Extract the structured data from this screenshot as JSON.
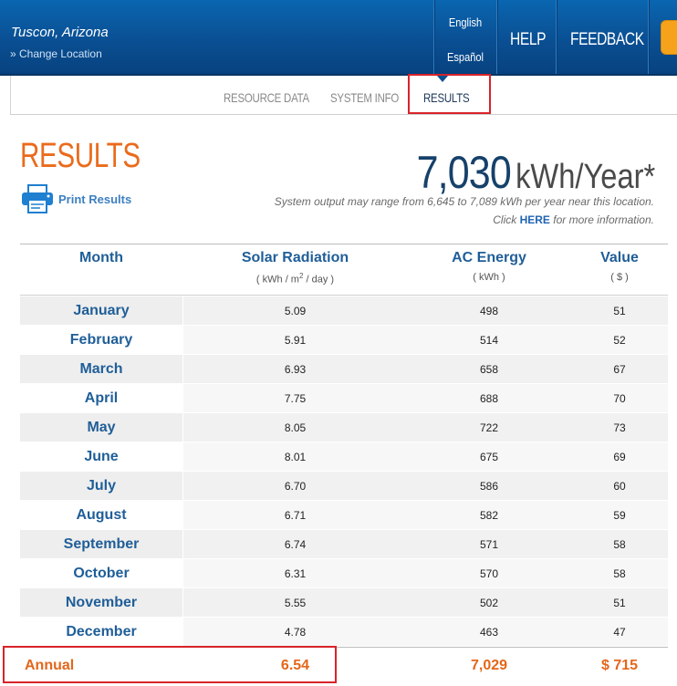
{
  "header": {
    "location": "Tuscon, Arizona",
    "change_location": "» Change Location",
    "lang_english": "English",
    "lang_spanish": "Español",
    "help": "HELP",
    "feedback": "FEEDBACK"
  },
  "tabs": {
    "resource_data": "RESOURCE DATA",
    "system_info": "SYSTEM INFO",
    "results": "RESULTS"
  },
  "results": {
    "title": "RESULTS",
    "print": "Print Results",
    "annual_output": "7,030",
    "unit": "kWh/Year*",
    "range_note": "System output may range from 6,645 to 7,089 kWh per year near this location.",
    "click": "Click",
    "here": "HERE",
    "more_info": "for more information."
  },
  "table": {
    "headers": {
      "month": "Month",
      "solar": "Solar Radiation",
      "solar_unit_pre": "( kWh / m",
      "solar_unit_sup": "2",
      "solar_unit_post": " / day )",
      "ac": "AC Energy",
      "ac_unit": "( kWh )",
      "value": "Value",
      "value_unit": "( $ )"
    },
    "rows": [
      {
        "month": "January",
        "solar": "5.09",
        "ac": "498",
        "value": "51"
      },
      {
        "month": "February",
        "solar": "5.91",
        "ac": "514",
        "value": "52"
      },
      {
        "month": "March",
        "solar": "6.93",
        "ac": "658",
        "value": "67"
      },
      {
        "month": "April",
        "solar": "7.75",
        "ac": "688",
        "value": "70"
      },
      {
        "month": "May",
        "solar": "8.05",
        "ac": "722",
        "value": "73"
      },
      {
        "month": "June",
        "solar": "8.01",
        "ac": "675",
        "value": "69"
      },
      {
        "month": "July",
        "solar": "6.70",
        "ac": "586",
        "value": "60"
      },
      {
        "month": "August",
        "solar": "6.71",
        "ac": "582",
        "value": "59"
      },
      {
        "month": "September",
        "solar": "6.74",
        "ac": "571",
        "value": "58"
      },
      {
        "month": "October",
        "solar": "6.31",
        "ac": "570",
        "value": "58"
      },
      {
        "month": "November",
        "solar": "5.55",
        "ac": "502",
        "value": "51"
      },
      {
        "month": "December",
        "solar": "4.78",
        "ac": "463",
        "value": "47"
      }
    ],
    "annual": {
      "label": "Annual",
      "solar": "6.54",
      "ac": "7,029",
      "value": "$ 715"
    }
  },
  "colors": {
    "header_blue": "#0a4f93",
    "accent_orange": "#ea6b1c",
    "highlight_red": "#d8232a",
    "link_blue": "#3d7fc1"
  },
  "icons": [
    "printer-icon"
  ]
}
